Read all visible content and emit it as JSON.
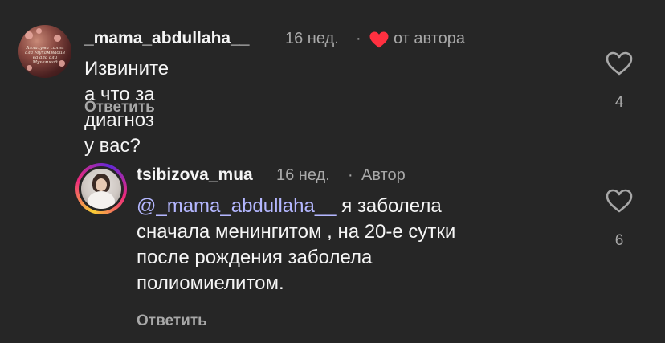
{
  "comment1": {
    "username": "_mama_abdullaha__",
    "time": "16 нед.",
    "separator": "·",
    "author_liked": "от автора",
    "text": "Извините а что за диагноз у вас?",
    "reply_label": "Ответить",
    "likes": "4",
    "avatar_inscription": "Аллахума салли ала Мухаммадин ва ала али Мухаммад"
  },
  "comment2": {
    "username": "tsibizova_mua",
    "time": "16 нед.",
    "separator": "·",
    "author_badge": "Автор",
    "mention": "@_mama_abdullaha__",
    "text_line1": " я заболела",
    "text_line2": "сначала менингитом , на 20-е сутки",
    "text_line3": "после рождения заболела",
    "text_line4": "полиомиелитом.",
    "reply_label": "Ответить",
    "likes": "6"
  },
  "colors": {
    "background": "#262626",
    "text": "#f5f5f5",
    "secondary": "#a8a8a8",
    "mention": "#b4b7ff",
    "heart_red": "#ff3040"
  },
  "icons": {
    "like": "heart-outline-icon",
    "author_like": "heart-filled-icon"
  }
}
